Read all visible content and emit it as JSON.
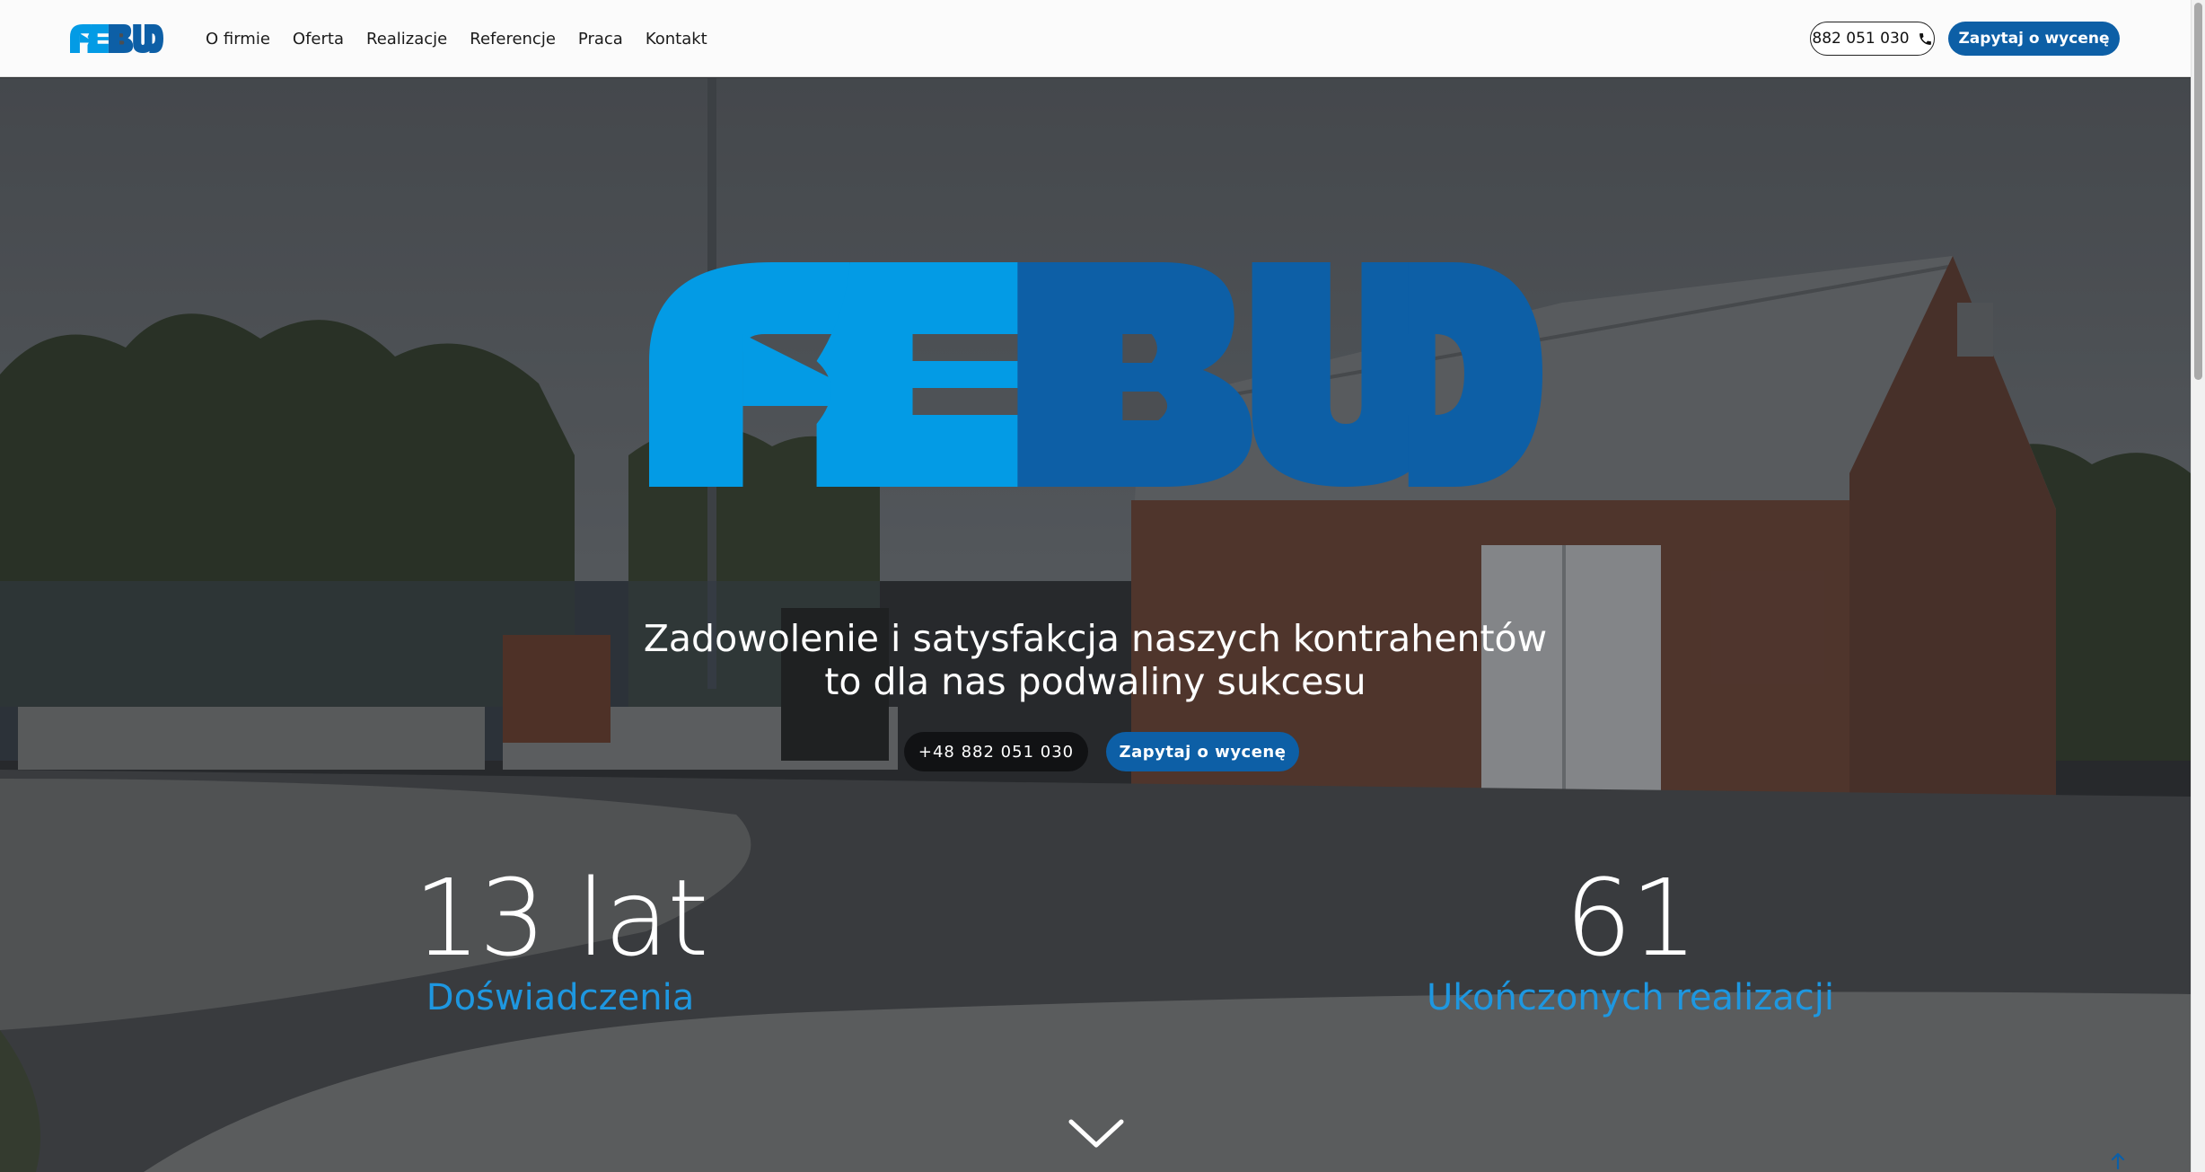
{
  "brand": {
    "logo_text": "PEBUD",
    "light_blue": "#039be5",
    "dark_blue": "#0d5fa6"
  },
  "nav": {
    "links": [
      "O firmie",
      "Oferta",
      "Realizacje",
      "Referencje",
      "Praca",
      "Kontakt"
    ],
    "phone": "882 051 030",
    "phone_icon": "phone-icon",
    "quote_label": "Zapytaj o wycenę"
  },
  "hero": {
    "headline_line1": "Zadowolenie i satysfakcja naszych kontrahentów",
    "headline_line2": "to dla nas podwaliny sukcesu",
    "phone_button": "+48 882 051 030",
    "quote_button": "Zapytaj o wycenę",
    "stats": [
      {
        "value": "13 lat",
        "label": "Doświadczenia"
      },
      {
        "value": "61",
        "label": "Ukończonych realizacji"
      }
    ],
    "scroll_down_icon": "chevron-down-icon",
    "back_to_top_icon": "arrow-up-icon",
    "label_color": "#1e97e0"
  }
}
